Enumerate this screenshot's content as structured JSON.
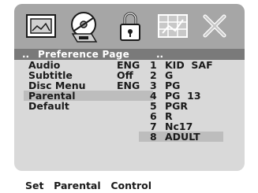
{
  "iconbar": {
    "icons": [
      "picture-icon",
      "audio-disc-icon",
      "lock-icon",
      "grid-icon",
      "close-icon"
    ],
    "selected": "lock-icon"
  },
  "header": {
    "prefix": "..",
    "title": "Preference Page",
    "suffix": ".."
  },
  "menu": {
    "items": [
      {
        "label": "Audio",
        "value": "ENG"
      },
      {
        "label": "Subtitle",
        "value": "Off"
      },
      {
        "label": "Disc  Menu",
        "value": "ENG"
      },
      {
        "label": "Parental",
        "value": ""
      },
      {
        "label": "Default",
        "value": ""
      }
    ],
    "selected_index": 3
  },
  "parental_options": [
    {
      "num": "1",
      "label": "KID  SAF"
    },
    {
      "num": "2",
      "label": "G"
    },
    {
      "num": "3",
      "label": "PG"
    },
    {
      "num": "4",
      "label": "PG  13"
    },
    {
      "num": "5",
      "label": "PGR"
    },
    {
      "num": "6",
      "label": "R"
    },
    {
      "num": "7",
      "label": "Nc17"
    },
    {
      "num": "8",
      "label": "ADULT"
    }
  ],
  "parental_selected_index": 7,
  "help_text": "Set  Parental  Control",
  "colors": {
    "panel": "#d9d9d9",
    "iconbar": "#a6a6a6",
    "header": "#7a7a7a",
    "highlight": "#bdbdbd"
  }
}
